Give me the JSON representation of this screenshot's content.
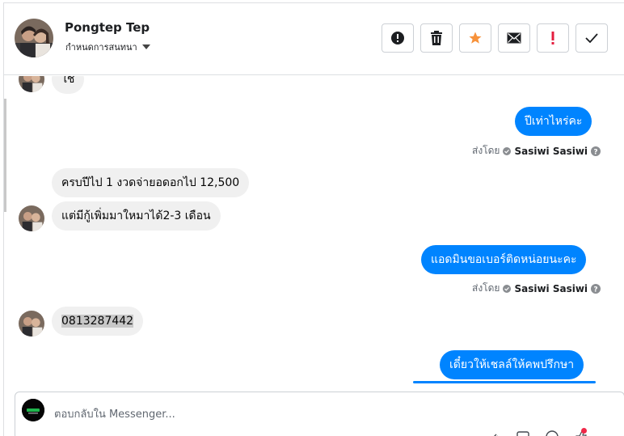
{
  "header": {
    "name": "Pongtep Tep",
    "subtitle": "กำหนดการสนทนา",
    "actions": [
      {
        "icon": "alert-circle-icon",
        "label": "report"
      },
      {
        "icon": "trash-icon",
        "label": "delete"
      },
      {
        "icon": "star-icon",
        "label": "star",
        "color": "#f7923b"
      },
      {
        "icon": "envelope-icon",
        "label": "mark unread"
      },
      {
        "icon": "exclamation-icon",
        "label": "spam",
        "color": "#e41e3f"
      },
      {
        "icon": "check-icon",
        "label": "done"
      }
    ]
  },
  "messages": {
    "msg_1": "ใช่",
    "msg_2": "ปีเท่าไหร่คะ",
    "msg_3": "ครบปีไป 1 งวดจ่ายอดอกไป 12,500",
    "msg_4": "แต่มีกู้เพิ่มมาใหมาได้2-3 เดือน",
    "msg_5": "แอดมินขอเบอร์ติดหน่อยนะคะ",
    "msg_6": "0813287442",
    "msg_7": "เดี๋ยวให้เชลล์ให้คพปรึกษา",
    "sent_by_prefix": "ส่งโดย",
    "sender": "Sasiwi Sasiwi"
  },
  "composer": {
    "placeholder": "ตอบกลับใน Messenger..."
  },
  "colors": {
    "outgoing_bubble": "#0084ff",
    "incoming_bubble": "#f0f0f0",
    "star": "#f7923b",
    "spam": "#e41e3f"
  }
}
